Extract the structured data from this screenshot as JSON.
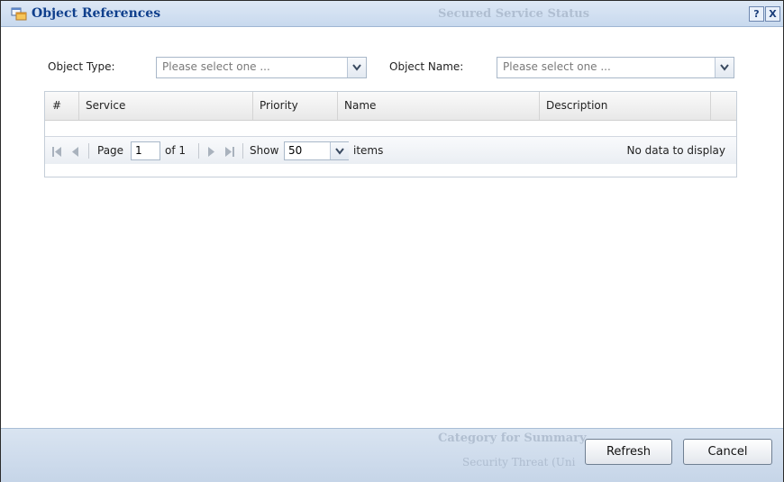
{
  "dialog": {
    "title": "Object References",
    "help_label": "?",
    "close_label": "X"
  },
  "filters": {
    "object_type_label": "Object Type:",
    "object_type_value": "Please select one ...",
    "object_name_label": "Object Name:",
    "object_name_value": "Please select one ..."
  },
  "table": {
    "columns": [
      "#",
      "Service",
      "Priority",
      "Name",
      "Description"
    ]
  },
  "pager": {
    "page_label": "Page",
    "page_value": "1",
    "of_label": "of 1",
    "show_label": "Show",
    "show_value": "50",
    "items_label": "items",
    "status": "No data to display"
  },
  "footer": {
    "refresh_label": "Refresh",
    "cancel_label": "Cancel"
  },
  "background": {
    "status_title": "Secured Service Status",
    "summary_title": "Category for Summary",
    "threat_label": "Security Threat (Uni"
  }
}
